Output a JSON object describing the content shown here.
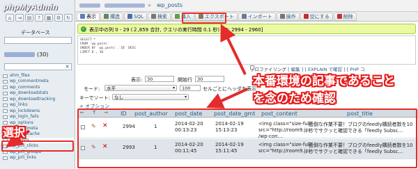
{
  "app": {
    "logo_php": "php",
    "logo_admin": "MyAdmin"
  },
  "sidebar": {
    "db_label": "データベース",
    "db_count": "(30)",
    "filter_clear": "×",
    "tables": [
      {
        "name": "ahm_files"
      },
      {
        "name": "wp_commentmeta"
      },
      {
        "name": "wp_comments"
      },
      {
        "name": "wp_downloadstats"
      },
      {
        "name": "wp_downloadtracking"
      },
      {
        "name": "wp_links"
      },
      {
        "name": "wp_lockdowns"
      },
      {
        "name": "wp_login_fails"
      },
      {
        "name": "wp_options"
      },
      {
        "name": "wp_postmeta"
      },
      {
        "name": "wp_datacache"
      },
      {
        "name": "wp_posts",
        "active": true
      },
      {
        "name": "wp_prli_clicks"
      },
      {
        "name": "wp_prli_groups"
      },
      {
        "name": "wp_prli_links"
      }
    ]
  },
  "breadcrumb": {
    "separator": "»",
    "table": "wp_posts"
  },
  "tabs": [
    {
      "label": "表示",
      "icon": "browse-icon",
      "color": "#5b7fb5",
      "active": true
    },
    {
      "label": "構造",
      "icon": "structure-icon",
      "color": "#5a8a5a"
    },
    {
      "label": "SQL",
      "icon": "sql-icon",
      "color": "#4a6fa5"
    },
    {
      "label": "検索",
      "icon": "search-icon",
      "color": "#777777"
    },
    {
      "label": "挿入",
      "icon": "insert-icon",
      "color": "#6a9a4a"
    },
    {
      "label": "エクスポート",
      "icon": "export-icon",
      "color": "#8a7a5a"
    },
    {
      "label": "インポート",
      "icon": "import-icon",
      "color": "#6a7a9a"
    },
    {
      "label": "操作",
      "icon": "operations-icon",
      "color": "#777777"
    },
    {
      "label": "空にする",
      "icon": "empty-icon",
      "color": "#c03030"
    },
    {
      "label": "削除",
      "icon": "drop-icon",
      "color": "#c03030"
    }
  ],
  "success": {
    "icon": "check-icon",
    "text": "表示中の列 0 - 29 (２,859 合計, クエリの実行時間 0.1 秒) [ID: 2994 - 2960]"
  },
  "sql": {
    "lines": [
      "SELECT *",
      "FROM `wp_posts`",
      "ORDER BY `wp_posts`.`ID` DESC",
      "LIMIT 0 , 30"
    ],
    "profiling_label": "プロファイリング",
    "edit_label": "[ 編集 ]",
    "explain_label": "[ EXPLAIN で確認 ]",
    "php_label": "[ PHP コ"
  },
  "controls": {
    "show_label": "表示:",
    "show_value": "30",
    "start_label": "開始行",
    "start_value": "30",
    "mode_label": "モード:",
    "mode_value": "水平",
    "repeat_value": "100",
    "repeat_suffix": "セルごとにヘッダを表示",
    "sort_label": "キーでソート:",
    "sort_value": "なし",
    "options_label": "+ オプション"
  },
  "results": {
    "columns": [
      "ID",
      "post_author",
      "post_date",
      "post_date_gmt",
      "post_content",
      "post_title"
    ],
    "rows": [
      {
        "id": "2994",
        "author": "1",
        "post_date": [
          "2014-02-20",
          "00:13:23"
        ],
        "post_date_gmt": [
          "2014-02-19",
          "15:13:23"
        ],
        "content": [
          "<img class=\"size-full\"",
          "src=\"http://room9.jp",
          "/wp-con..."
        ],
        "title": [
          "面倒な作業不要！ブログのfeedly購読者数を10",
          "秒でサクッと確認できる「feedly Subsc..."
        ]
      },
      {
        "id": "2993",
        "author": "1",
        "post_date": [
          "2014-02-20",
          "00:11:45"
        ],
        "post_date_gmt": [
          "2014-02-19",
          "15:11:45"
        ],
        "content": [
          "<img class=\"size-full\"",
          "src=\"http://room9.jp"
        ],
        "title": [
          "面倒な作業不要！ブログのfeedly購読者数を10",
          "秒でサクッと確認できる「feedly Subsc..."
        ]
      }
    ]
  },
  "annotations": {
    "select_label": "選択",
    "caption_line1": "本番環境の記事であること",
    "caption_line2": "を念のため確認",
    "color": "#e52b2b"
  }
}
